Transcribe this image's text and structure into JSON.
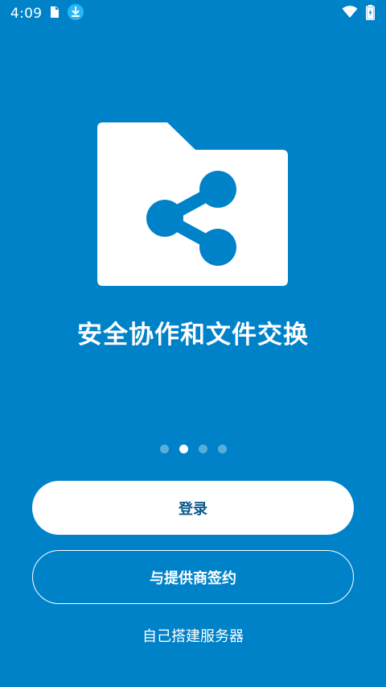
{
  "status_bar": {
    "time": "4:09",
    "left_icons": [
      "sim-card-icon",
      "download-icon"
    ],
    "right_icons": [
      "wifi-icon",
      "battery-charging-icon"
    ]
  },
  "hero": {
    "icon": "folder-share-icon",
    "tagline": "安全协作和文件交换"
  },
  "pager": {
    "total": 4,
    "active_index": 1
  },
  "actions": {
    "login_label": "登录",
    "provider_label": "与提供商签约",
    "own_server_label": "自己搭建服务器"
  },
  "colors": {
    "background": "#0082c9",
    "login_text": "#0b5a8e",
    "foreground": "#ffffff"
  }
}
